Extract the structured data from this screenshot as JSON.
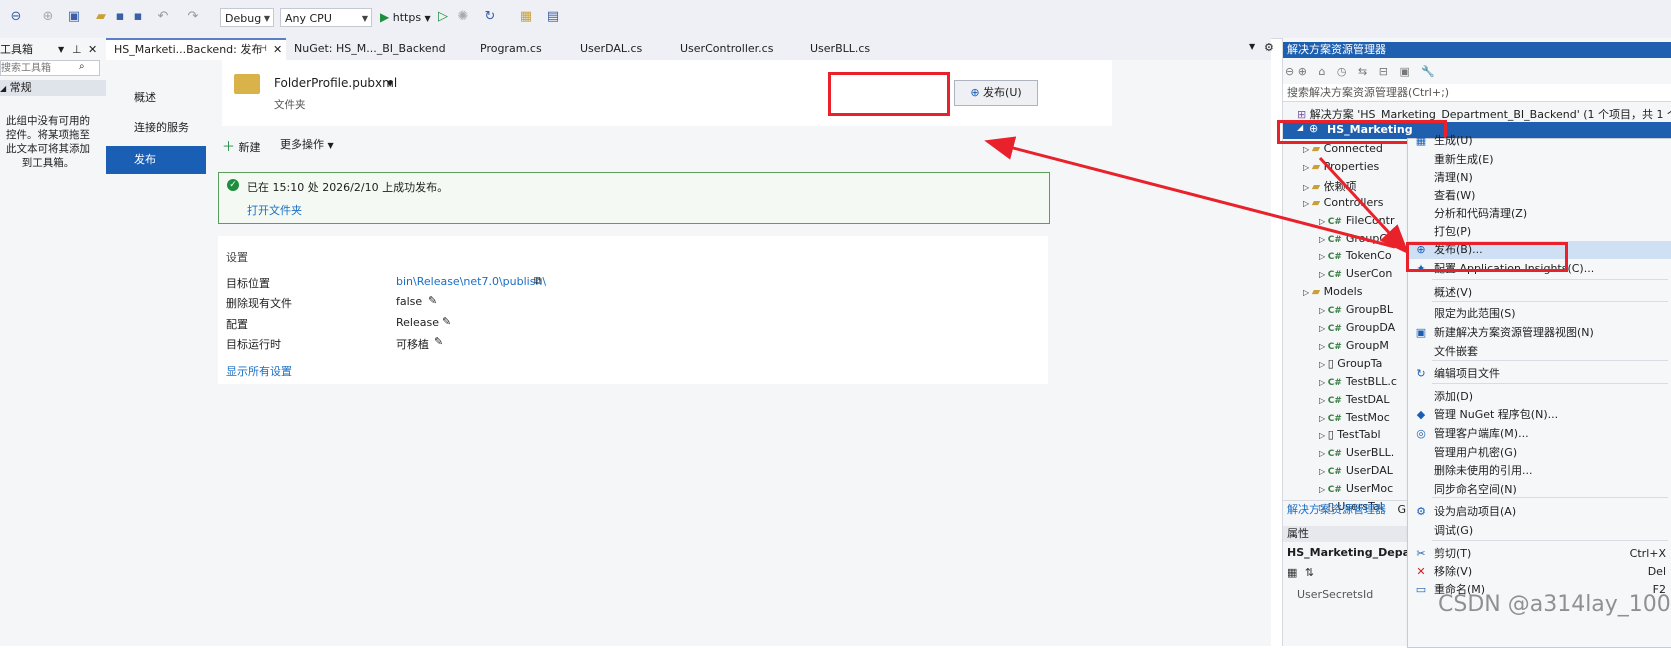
{
  "toolbar": {
    "config": "Debug",
    "platform": "Any CPU",
    "run_target": "https"
  },
  "toolbox": {
    "title": "工具箱",
    "search_placeholder": "搜索工具箱",
    "group": "常规",
    "empty_message": "此组中没有可用的控件。将某项拖至此文本可将其添加到工具箱。"
  },
  "tabs": [
    {
      "label": "HS_Marketi...Backend: 发布"
    },
    {
      "label": "NuGet: HS_M..._BI_Backend"
    },
    {
      "label": "Program.cs"
    },
    {
      "label": "UserDAL.cs"
    },
    {
      "label": "UserController.cs"
    },
    {
      "label": "UserBLL.cs"
    }
  ],
  "publish": {
    "nav": [
      "概述",
      "连接的服务",
      "发布"
    ],
    "profile_name": "FolderProfile.pubxml",
    "profile_type": "文件夹",
    "publish_button": "发布(U)",
    "new_label": "新建",
    "more_actions": "更多操作",
    "success_message": "已在 15:10 处 2026/2/10 上成功发布。",
    "open_folder": "打开文件夹",
    "settings_title": "设置",
    "settings": [
      {
        "label": "目标位置",
        "value": "bin\\Release\\net7.0\\publish\\"
      },
      {
        "label": "删除现有文件",
        "value": "false"
      },
      {
        "label": "配置",
        "value": "Release"
      },
      {
        "label": "目标运行时",
        "value": "可移植"
      }
    ],
    "show_all": "显示所有设置"
  },
  "solution_explorer": {
    "title": "解决方案资源管理器",
    "search_placeholder": "搜索解决方案资源管理器(Ctrl+;)",
    "solution_line": "解决方案 'HS_Marketing_Department_BI_Backend' (1 个项目，共 1 个",
    "project": "HS_Marketing",
    "items": [
      {
        "text": "Connected",
        "type": "folder"
      },
      {
        "text": "Properties",
        "type": "folder"
      },
      {
        "text": "依赖项",
        "type": "folder"
      },
      {
        "text": "Controllers",
        "type": "folder"
      },
      {
        "text": "FileContr",
        "type": "cs"
      },
      {
        "text": "GroupCo",
        "type": "cs"
      },
      {
        "text": "TokenCo",
        "type": "cs"
      },
      {
        "text": "UserCon",
        "type": "cs"
      },
      {
        "text": "Models",
        "type": "folder"
      },
      {
        "text": "GroupBL",
        "type": "cs"
      },
      {
        "text": "GroupDA",
        "type": "cs"
      },
      {
        "text": "GroupM",
        "type": "cs"
      },
      {
        "text": "GroupTa",
        "type": "file"
      },
      {
        "text": "TestBLL.c",
        "type": "cs"
      },
      {
        "text": "TestDAL",
        "type": "cs"
      },
      {
        "text": "TestMoc",
        "type": "cs"
      },
      {
        "text": "TestTabl",
        "type": "file"
      },
      {
        "text": "UserBLL.",
        "type": "cs"
      },
      {
        "text": "UserDAL",
        "type": "cs"
      },
      {
        "text": "UserMoc",
        "type": "cs"
      },
      {
        "text": "UsersTal",
        "type": "file"
      }
    ],
    "bottom_tabs": [
      "解决方案资源管理器",
      "Gi"
    ],
    "properties_title": "属性",
    "properties_object": "HS_Marketing_Depart",
    "properties_row": "UserSecretsId"
  },
  "context_menu": {
    "items": [
      {
        "label": "生成(U)",
        "icon": "build-icon"
      },
      {
        "label": "重新生成(E)",
        "icon": ""
      },
      {
        "label": "清理(N)",
        "icon": ""
      },
      {
        "label": "查看(W)",
        "icon": ""
      },
      {
        "label": "分析和代码清理(Z)",
        "icon": ""
      },
      {
        "label": "打包(P)",
        "icon": ""
      },
      {
        "label": "发布(B)...",
        "icon": "publish-globe-icon"
      },
      {
        "label": "配置 Application Insights(C)...",
        "icon": "insights-icon"
      },
      {
        "label": "概述(V)",
        "icon": ""
      },
      {
        "label": "限定为此范围(S)",
        "icon": ""
      },
      {
        "label": "新建解决方案资源管理器视图(N)",
        "icon": "new-view-icon"
      },
      {
        "label": "文件嵌套",
        "icon": ""
      },
      {
        "label": "编辑项目文件",
        "icon": "refresh-icon"
      },
      {
        "label": "添加(D)",
        "icon": ""
      },
      {
        "label": "管理 NuGet 程序包(N)...",
        "icon": "nuget-icon"
      },
      {
        "label": "管理客户端库(M)...",
        "icon": "client-lib-icon"
      },
      {
        "label": "管理用户机密(G)",
        "icon": ""
      },
      {
        "label": "删除未使用的引用...",
        "icon": ""
      },
      {
        "label": "同步命名空间(N)",
        "icon": ""
      },
      {
        "label": "设为启动项目(A)",
        "icon": "gear-icon"
      },
      {
        "label": "调试(G)",
        "icon": ""
      },
      {
        "label": "剪切(T)",
        "icon": "cut-icon",
        "shortcut": "Ctrl+X"
      },
      {
        "label": "移除(V)",
        "icon": "remove-icon",
        "shortcut": "Del"
      },
      {
        "label": "重命名(M)",
        "icon": "rename-icon",
        "shortcut": "F2"
      }
    ]
  },
  "watermark": "CSDN @a314lay_1007"
}
